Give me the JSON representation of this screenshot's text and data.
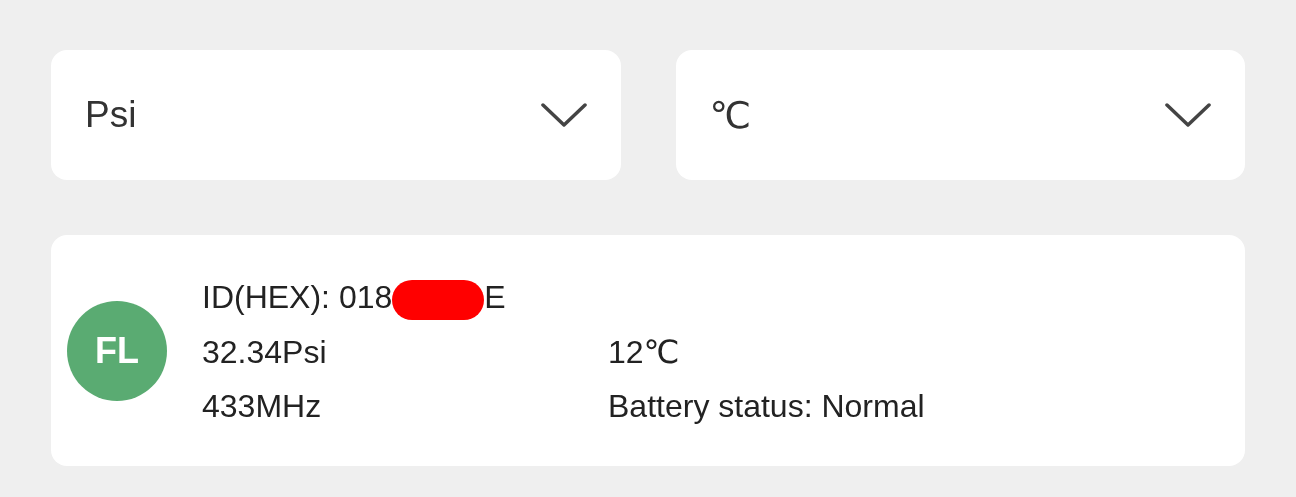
{
  "unit_selects": [
    {
      "value": "Psi"
    },
    {
      "value": "℃"
    }
  ],
  "sensor": {
    "position": "FL",
    "color": "#5aab72",
    "id_label": "ID(HEX): 018",
    "id_tail": "E",
    "redacted": true,
    "pressure": "32.34Psi",
    "temperature": "12℃",
    "frequency": "433MHz",
    "battery": "Battery status: Normal"
  }
}
